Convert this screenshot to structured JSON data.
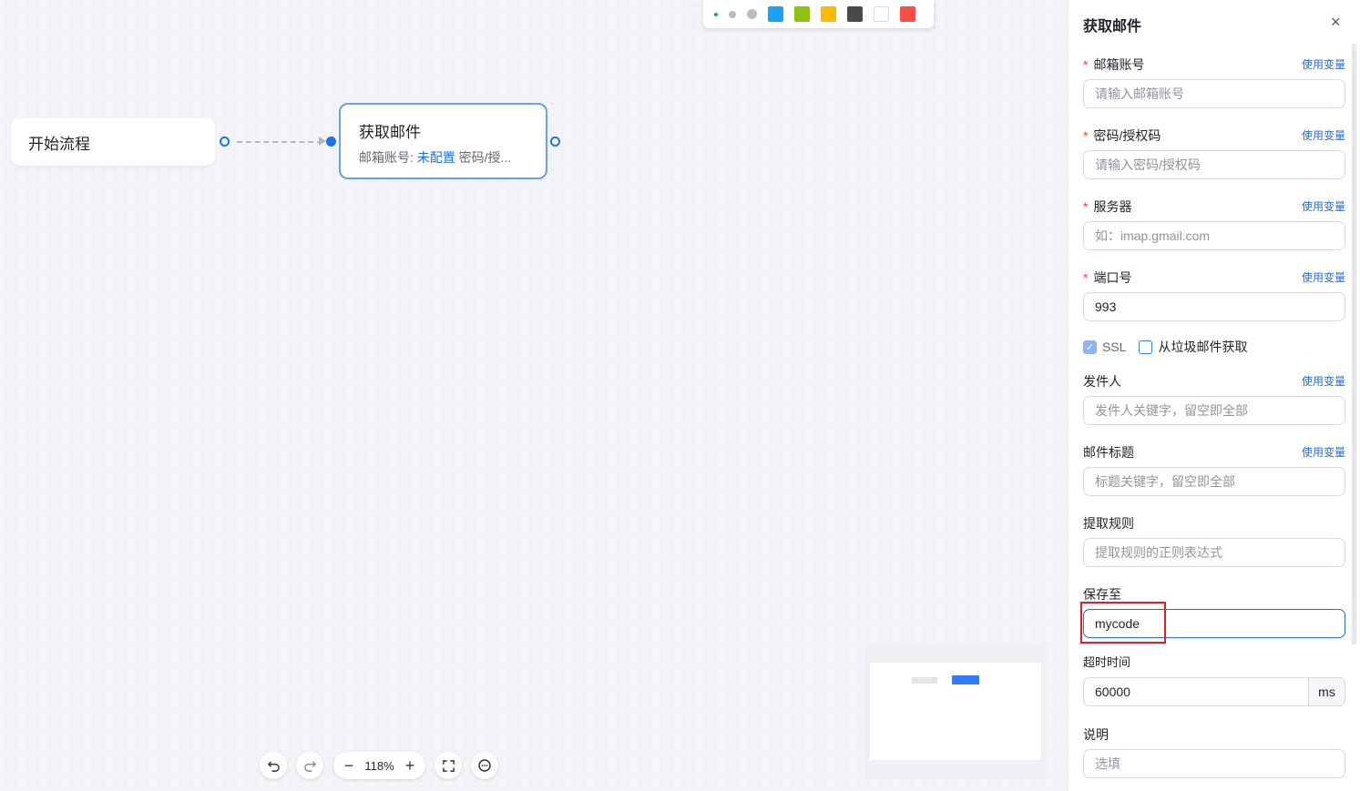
{
  "toolbar_colors": {
    "dots": [
      "small",
      "medium",
      "large"
    ],
    "swatches": [
      "#1aa3f5",
      "#8cc312",
      "#fcb900",
      "#4a4a4a",
      "#ffffff",
      "#f5504a"
    ]
  },
  "canvas": {
    "start_node": {
      "label": "开始流程"
    },
    "mail_node": {
      "title": "获取邮件",
      "desc_prefix": "邮箱账号: ",
      "desc_status": "未配置",
      "desc_suffix": " 密码/授..."
    }
  },
  "bottom_toolbar": {
    "undo_icon": "undo-icon",
    "redo_icon": "redo-icon",
    "zoom_out": "−",
    "zoom_level": "118%",
    "zoom_in": "+",
    "fit_icon": "fit-screen-icon",
    "comment_icon": "comment-icon"
  },
  "panel": {
    "title": "获取邮件",
    "close": "×",
    "use_variable": "使用变量",
    "fields": {
      "email": {
        "label": "邮箱账号",
        "required": "*",
        "placeholder": "请输入邮箱账号"
      },
      "password": {
        "label": "密码/授权码",
        "required": "*",
        "placeholder": "请输入密码/授权码"
      },
      "server": {
        "label": "服务器",
        "required": "*",
        "placeholder": "如：imap.gmail.com"
      },
      "port": {
        "label": "端口号",
        "required": "*",
        "value": "993"
      },
      "ssl": {
        "label": "SSL",
        "checked": true
      },
      "spam": {
        "label": "从垃圾邮件获取",
        "checked": false
      },
      "sender": {
        "label": "发件人",
        "placeholder": "发件人关键字，留空即全部"
      },
      "subject": {
        "label": "邮件标题",
        "placeholder": "标题关键字，留空即全部"
      },
      "rule": {
        "label": "提取规则",
        "placeholder": "提取规则的正则表达式"
      },
      "save_to": {
        "label": "保存至",
        "value": "mycode"
      },
      "timeout": {
        "label": "超时时间",
        "value": "60000",
        "unit": "ms"
      },
      "note": {
        "label": "说明",
        "placeholder": "选填"
      }
    }
  }
}
